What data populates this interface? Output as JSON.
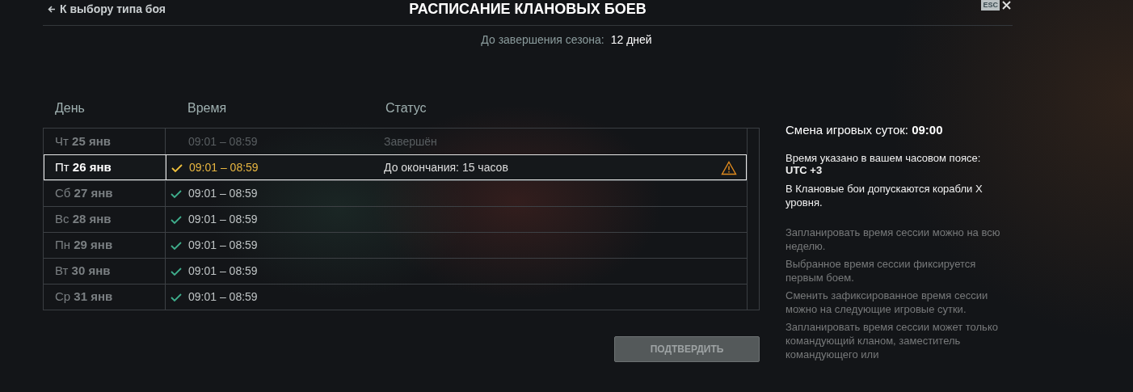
{
  "header": {
    "back_link": "К выбору типа боя",
    "title": "РАСПИСАНИЕ КЛАНОВЫХ БОЕВ",
    "esc_key": "ESC"
  },
  "season": {
    "label": "До завершения сезона:",
    "value": "12 дней"
  },
  "table": {
    "columns": [
      "День",
      "Время",
      "Статус"
    ],
    "rows": [
      {
        "day": "Чт **25 янв**",
        "time": "09:01 – 08:59",
        "status": "Завершён",
        "kind": "finished",
        "selected": false,
        "checked": false,
        "warning": false
      },
      {
        "day": "Пт **26 янв**",
        "time": "09:01 – 08:59",
        "status": "До окончания: 15 часов",
        "kind": "current",
        "selected": true,
        "checked": true,
        "warning": true
      },
      {
        "day": "Сб **27 янв**",
        "time": "09:01 – 08:59",
        "kind": "planned",
        "selected": false,
        "checked": true,
        "warning": false
      },
      {
        "day": "Вс **28 янв**",
        "time": "09:01 – 08:59",
        "kind": "planned",
        "selected": false,
        "checked": true,
        "warning": false
      },
      {
        "day": "Пн **29 янв**",
        "time": "09:01 – 08:59",
        "kind": "planned",
        "selected": false,
        "checked": true,
        "warning": false
      },
      {
        "day": "Вт **30 янв**",
        "time": "09:01 – 08:59",
        "kind": "planned",
        "selected": false,
        "checked": true,
        "warning": false
      },
      {
        "day": "Ср **31 янв**",
        "time": "09:01 – 08:59",
        "kind": "planned",
        "selected": false,
        "checked": true,
        "warning": false
      }
    ]
  },
  "confirm_button": {
    "label": "ПОДТВЕРДИТЬ",
    "disabled": true
  },
  "info": [
    {
      "kind": "heading",
      "text": "Смена игровых суток: **09:00**"
    },
    {
      "kind": "note",
      "text": "Время указано в вашем часовом поясе:",
      "value": "UTC +3"
    },
    {
      "kind": "note",
      "text": "В Клановые бои допускаются корабли X уровня."
    },
    {
      "kind": "hint",
      "text": "Запланировать время сессии можно на всю неделю."
    },
    {
      "kind": "hint",
      "text": "Выбранное время сессии фиксируется первым боем."
    },
    {
      "kind": "hint",
      "text": "Сменить зафиксированное время сессии можно на следующие игровые сутки."
    },
    {
      "kind": "hint",
      "text": "Запланировать время сессии может только командующий кланом, заместитель командующего или"
    }
  ]
}
